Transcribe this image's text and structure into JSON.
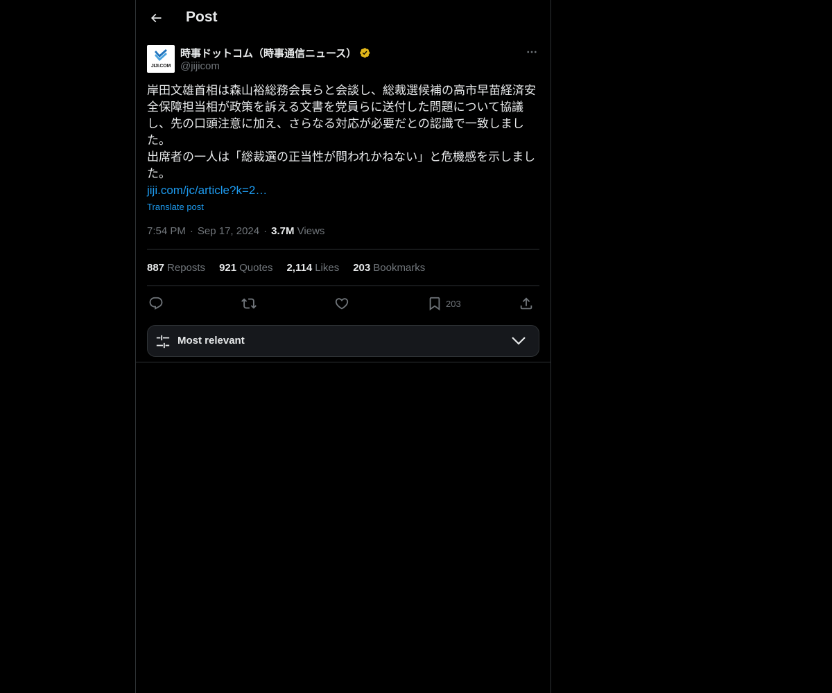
{
  "header": {
    "title": "Post"
  },
  "author": {
    "display_name": "時事ドットコム（時事通信ニュース）",
    "handle": "@jijicom",
    "avatar_text": "JIJI.COM",
    "verified_color": "#e2b719"
  },
  "post": {
    "text": "岸田文雄首相は森山裕総務会長らと会談し、総裁選候補の高市早苗経済安\n全保障担当相が政策を訴える文書を党員らに送付した問題について協議\nし、先の口頭注意に加え、さらなる対応が必要だとの認識で一致しまし\nた。\n出席者の一人は「総裁選の正当性が問われかねない」と危機感を示しまし\nた。",
    "link": "jiji.com/jc/article?k=2…",
    "translate_label": "Translate post"
  },
  "meta": {
    "time": "7:54 PM",
    "date": "Sep 17, 2024",
    "views_count": "3.7M",
    "views_label": "Views",
    "separator": "·"
  },
  "stats": [
    {
      "count": "887",
      "label": "Reposts"
    },
    {
      "count": "921",
      "label": "Quotes"
    },
    {
      "count": "2,114",
      "label": "Likes"
    },
    {
      "count": "203",
      "label": "Bookmarks"
    }
  ],
  "actions": {
    "bookmark_count": "203",
    "icons": [
      "reply-icon",
      "repost-icon",
      "like-icon",
      "bookmark-icon",
      "share-icon"
    ]
  },
  "sort": {
    "label": "Most relevant"
  },
  "colors": {
    "background": "#000000",
    "text": "#e7e9ea",
    "muted": "#71767b",
    "accent": "#1d9bf0",
    "border": "#2f3336"
  }
}
